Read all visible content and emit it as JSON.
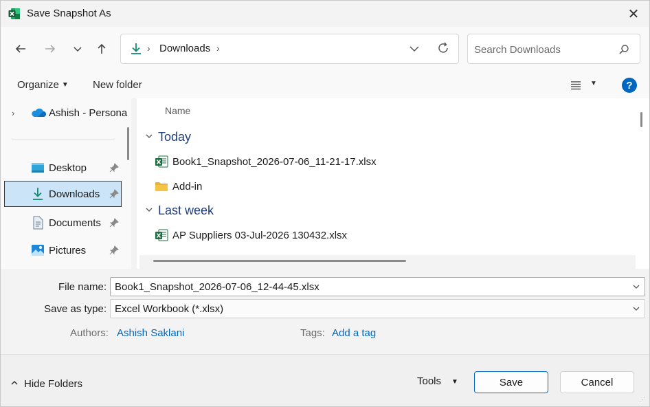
{
  "window": {
    "title": "Save Snapshot As",
    "close_glyph": "✕"
  },
  "navigation": {
    "back_glyph": "←",
    "forward_glyph": "→",
    "recent_glyph": "⌄",
    "up_glyph": "↑"
  },
  "addressbar": {
    "icon": "downloads-icon",
    "separator": "›",
    "location": "Downloads"
  },
  "search": {
    "placeholder": "Search Downloads"
  },
  "commandbar": {
    "organize_label": "Organize",
    "new_folder_label": "New folder",
    "help_label": "?"
  },
  "navpane": {
    "cloud_item": {
      "label": "Ashish - Persona",
      "icon": "onedrive-cloud-icon",
      "expand_glyph": "›"
    },
    "quick_access": [
      {
        "label": "Desktop",
        "icon": "desktop-icon",
        "pinned": true,
        "selected": false
      },
      {
        "label": "Downloads",
        "icon": "downloads-icon",
        "pinned": true,
        "selected": true
      },
      {
        "label": "Documents",
        "icon": "documents-icon",
        "pinned": true,
        "selected": false
      },
      {
        "label": "Pictures",
        "icon": "pictures-icon",
        "pinned": true,
        "selected": false
      }
    ]
  },
  "filelist": {
    "column_name": "Name",
    "groups": [
      {
        "label": "Today",
        "items": [
          {
            "name": "Book1_Snapshot_2026-07-06_11-21-17.xlsx",
            "icon": "excel-file-icon"
          },
          {
            "name": "Add-in",
            "icon": "folder-icon"
          }
        ]
      },
      {
        "label": "Last week",
        "items": [
          {
            "name": "AP Suppliers 03-Jul-2026 130432.xlsx",
            "icon": "excel-file-icon"
          }
        ]
      }
    ]
  },
  "form": {
    "file_name_label": "File name:",
    "file_name_value": "Book1_Snapshot_2026-07-06_12-44-45.xlsx",
    "save_type_label": "Save as type:",
    "save_type_value": "Excel Workbook (*.xlsx)",
    "authors_label": "Authors:",
    "authors_value": "Ashish Saklani",
    "tags_label": "Tags:",
    "tags_value": "Add a tag"
  },
  "footer": {
    "hide_folders_label": "Hide Folders",
    "tools_label": "Tools",
    "save_label": "Save",
    "cancel_label": "Cancel"
  },
  "colors": {
    "accent": "#0067c0",
    "selection": "#cce4f7",
    "excel_green": "#1d6f42",
    "folder_yellow": "#f4c542",
    "group_header": "#1f3d7a"
  }
}
